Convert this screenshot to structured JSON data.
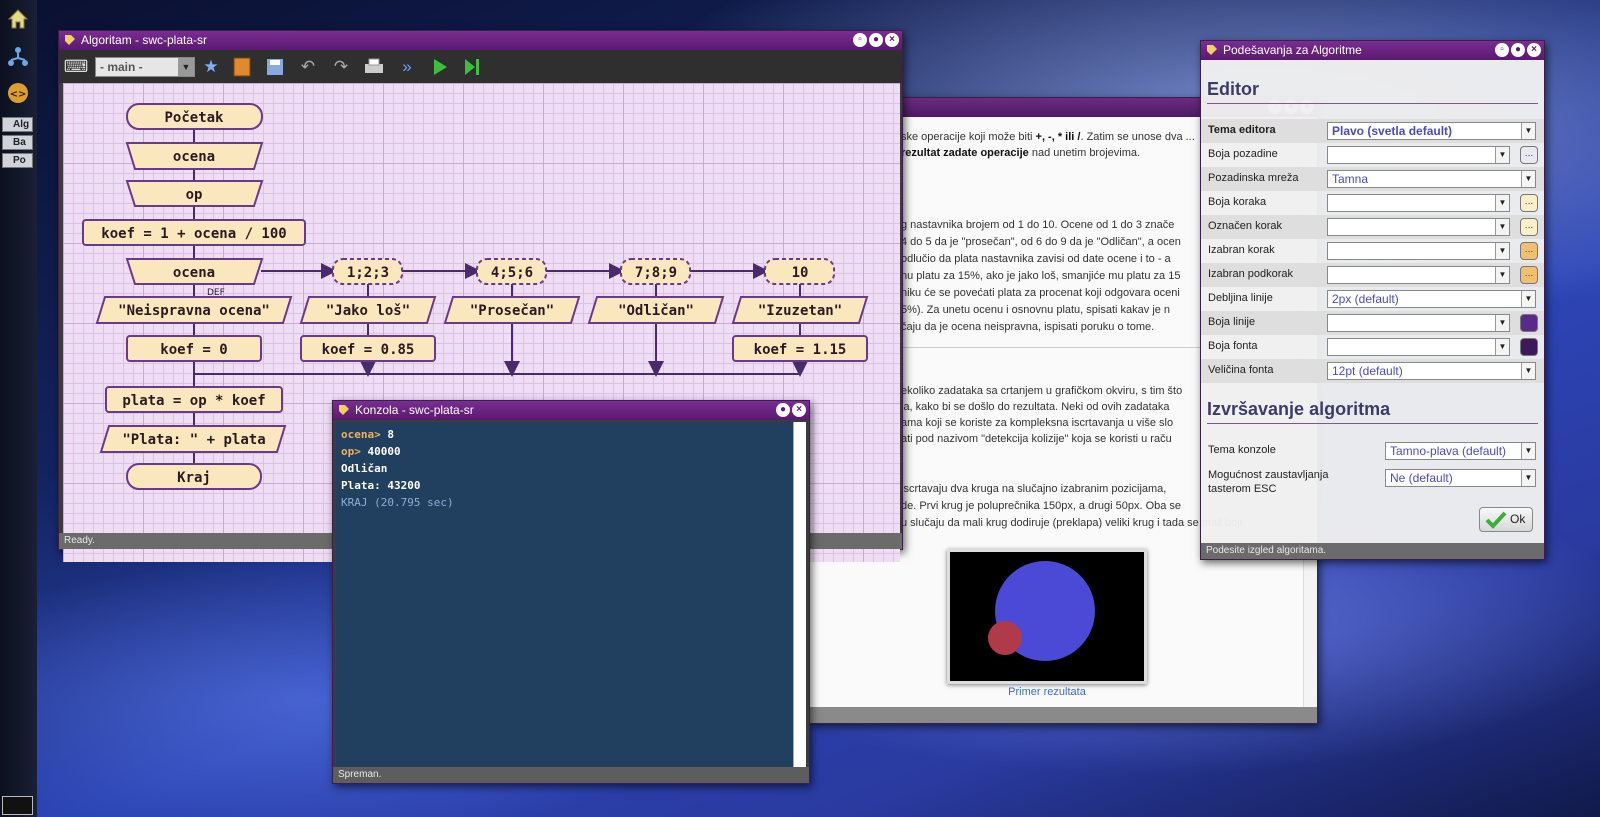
{
  "dock": {
    "tabs": [
      "Alg",
      "Ba",
      "Po"
    ],
    "icons": [
      "home-icon",
      "network-icon",
      "code-icon"
    ]
  },
  "algo_window": {
    "title": "Algoritam - swc-plata-sr",
    "function_select": "- main -",
    "status": "Ready.",
    "flowchart": {
      "start": "Početak",
      "input1": "ocena",
      "input2": "op",
      "assign_koef": "koef = 1 + ocena / 100",
      "switch": "ocena",
      "default_label": "DEF",
      "cases": [
        "1;2;3",
        "4;5;6",
        "7;8;9",
        "10"
      ],
      "outputs": [
        "\"Neispravna ocena\"",
        "\"Jako loš\"",
        "\"Prosečan\"",
        "\"Odličan\"",
        "\"Izuzetan\""
      ],
      "assign_default": "koef = 0",
      "assign_case1": "koef = 0.85",
      "assign_case4": "koef = 1.15",
      "assign_plata": "plata = op * koef",
      "output_plata": "\"Plata: \" + plata",
      "end": "Kraj"
    }
  },
  "console_window": {
    "title": "Konzola - swc-plata-sr",
    "lines": [
      {
        "prompt": "ocena>",
        "value": "8"
      },
      {
        "prompt": "op>",
        "value": "40000"
      }
    ],
    "output": [
      "Odličan",
      "Plata: 43200"
    ],
    "finished": "KRAJ (20.795 sec)",
    "status": "Spreman."
  },
  "task_window": {
    "paragraphs": [
      [
        "ske operacije koji može biti ",
        "+, -, * ili /",
        ". Zatim se unose dva ..."
      ],
      [
        "",
        "rezultat zadate operacije",
        " nad unetim brojevima."
      ]
    ],
    "p2": [
      "g nastavnika brojem od 1 do 10. Ocene od 1 do 3 znače",
      "4 do 5 da je \"prosečan\", od 6 do 9 da je \"Odličan\", a ocen",
      "odlučio da plata nastavnika zavisi od date ocene i to - a",
      "nu platu za 15%, ako je jako loš, smanjiće mu platu za 15",
      "niku će se povećati plata za procenat koji odgovara oceni",
      "5%). Za unetu ocenu i osnovnu platu, spisati kakav je n",
      "čaju da je ocena neispravna, ispisati poruku o tome."
    ],
    "p3": [
      "ekoliko zadataka sa crtanjem u grafičkom okviru, s tim što",
      "ja, kako bi se došlo do rezultata. Neki od ovih zadataka",
      "ama koji se koriste za kompleksna iscrtavanja u više slo",
      "ati pod nazivom \"detekcija kolizije\" koja se koristi u raču"
    ],
    "p4": [
      "iscrtavaju dva kruga na slučajno izabranim pozicijama,",
      "de. Prvi krug je poluprečnika 150px, a drugi 50px. Oba se",
      "u slučaju da mali krug dodiruje (preklapa) veliki krug i tada se mali boji"
    ],
    "image_caption": "Primer rezultata",
    "colors": {
      "big_circle": "#4a4ad6",
      "small_circle": "#b03a4a"
    }
  },
  "settings_window": {
    "title": "Podešavanja za Algoritme",
    "editor_heading": "Editor",
    "rows": [
      {
        "label": "Tema editora",
        "value": "Plavo (svetla default)",
        "bold": true
      },
      {
        "label": "Boja pozadine",
        "value": "",
        "swatch": "#e8e8f0"
      },
      {
        "label": "Pozadinska mreža",
        "value": "Tamna"
      },
      {
        "label": "Boja koraka",
        "value": "",
        "swatch": "#f7f0c8"
      },
      {
        "label": "Označen korak",
        "value": "",
        "swatch": "#f7f0c8"
      },
      {
        "label": "Izabran korak",
        "value": "",
        "swatch": "#f0c070"
      },
      {
        "label": "Izabran podkorak",
        "value": "",
        "swatch": "#f0c070"
      },
      {
        "label": "Debljina linije",
        "value": "2px (default)"
      },
      {
        "label": "Boja linije",
        "value": "",
        "swatch": "#5a2a8a"
      },
      {
        "label": "Boja fonta",
        "value": "",
        "swatch": "#3a1a5a"
      },
      {
        "label": "Veličina fonta",
        "value": "12pt (default)"
      }
    ],
    "exec_heading": "Izvršavanje algoritma",
    "exec_rows": [
      {
        "label": "Tema konzole",
        "value": "Tamno-plava (default)"
      },
      {
        "label": "Mogućnost zaustavljanja tasterom ESC",
        "value": "Ne (default)"
      }
    ],
    "ok_label": "Ok",
    "status": "Podesite izgled algoritama."
  }
}
